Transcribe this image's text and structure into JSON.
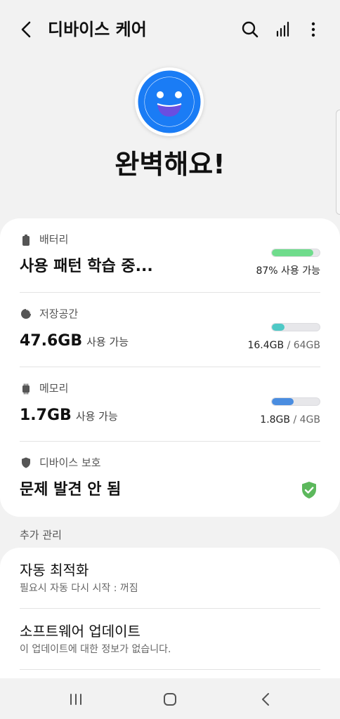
{
  "header": {
    "title": "디바이스 케어",
    "icons": [
      "back-arrow-icon",
      "search-icon",
      "signal-bars-icon",
      "more-vert-icon"
    ]
  },
  "status": {
    "title": "완벽해요!",
    "icon": "smiley-face-icon",
    "accent": "#1a7cf5"
  },
  "items": {
    "battery": {
      "label": "배터리",
      "value": "사용 패턴 학습 중...",
      "right": "87% 사용 가능",
      "level": 0.87,
      "color": "#6fdc8c"
    },
    "storage": {
      "label": "저장공간",
      "value": "47.6GB",
      "suffix": "사용 가능",
      "used": "16.4GB",
      "total": "/ 64GB",
      "level": 0.26,
      "color": "#4ec9c6"
    },
    "memory": {
      "label": "메모리",
      "value": "1.7GB",
      "suffix": "사용 가능",
      "used": "1.8GB",
      "total": "/ 4GB",
      "level": 0.45,
      "color": "#4a8de0"
    },
    "protection": {
      "label": "디바이스 보호",
      "value": "문제 발견 안 됨",
      "icon": "shield-check-icon",
      "color": "#5cb85c"
    }
  },
  "extra": {
    "section_label": "추가 관리",
    "options": [
      {
        "title": "자동 최적화",
        "subtitle": "필요시 자동 다시 시작 : 꺼짐"
      },
      {
        "title": "소프트웨어 업데이트",
        "subtitle": "이 업데이트에 대한 정보가 없습니다."
      }
    ]
  },
  "navbar": {
    "icons": [
      "recents-icon",
      "home-icon",
      "back-icon"
    ]
  }
}
